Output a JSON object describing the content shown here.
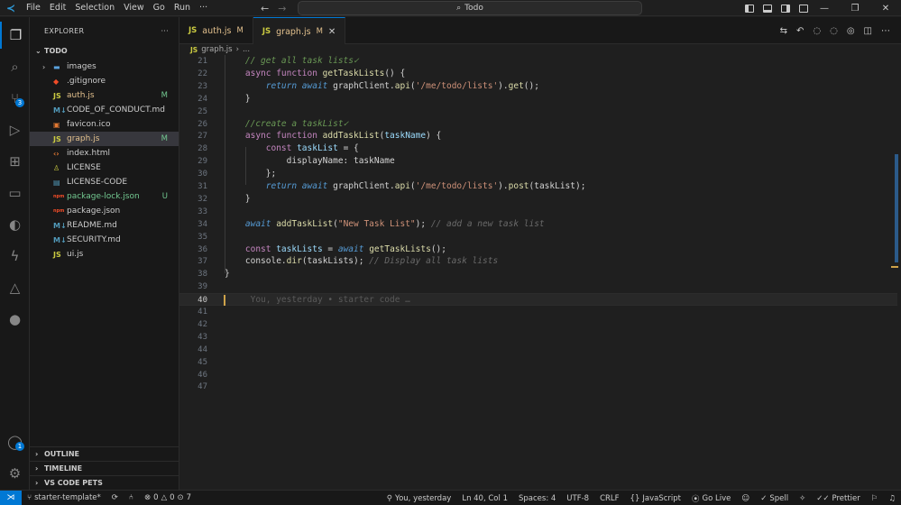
{
  "menu": [
    "File",
    "Edit",
    "Selection",
    "View",
    "Go",
    "Run",
    "···"
  ],
  "command_center": {
    "text": "Todo"
  },
  "explorer": {
    "title": "EXPLORER",
    "more": "···",
    "folder": "TODO",
    "items": [
      {
        "name": "images",
        "type": "folder",
        "status": "",
        "badge": ""
      },
      {
        "name": ".gitignore",
        "type": "git",
        "status": "",
        "badge": ""
      },
      {
        "name": "auth.js",
        "type": "js",
        "status": "modified",
        "badge": "M"
      },
      {
        "name": "CODE_OF_CONDUCT.md",
        "type": "md",
        "status": "",
        "badge": ""
      },
      {
        "name": "favicon.ico",
        "type": "ico",
        "status": "",
        "badge": ""
      },
      {
        "name": "graph.js",
        "type": "js",
        "status": "modified",
        "badge": "M"
      },
      {
        "name": "index.html",
        "type": "html",
        "status": "",
        "badge": ""
      },
      {
        "name": "LICENSE",
        "type": "license",
        "status": "",
        "badge": ""
      },
      {
        "name": "LICENSE-CODE",
        "type": "license-code",
        "status": "",
        "badge": ""
      },
      {
        "name": "package-lock.json",
        "type": "npm",
        "status": "untracked",
        "badge": "U"
      },
      {
        "name": "package.json",
        "type": "npm",
        "status": "",
        "badge": ""
      },
      {
        "name": "README.md",
        "type": "md",
        "status": "",
        "badge": ""
      },
      {
        "name": "SECURITY.md",
        "type": "md",
        "status": "",
        "badge": ""
      },
      {
        "name": "ui.js",
        "type": "js",
        "status": "",
        "badge": ""
      }
    ],
    "sections": [
      "OUTLINE",
      "TIMELINE",
      "VS CODE PETS"
    ]
  },
  "tabs": [
    {
      "lang": "JS",
      "name": "auth.js",
      "badge": "M",
      "active": false
    },
    {
      "lang": "JS",
      "name": "graph.js",
      "badge": "M",
      "active": true
    }
  ],
  "breadcrumb": {
    "lang": "JS",
    "file": "graph.js",
    "sep": "›",
    "more": "..."
  },
  "editor": {
    "lines": [
      {
        "n": "21",
        "tokens": [
          [
            "cm",
            "    // get all task lists✓"
          ]
        ]
      },
      {
        "n": "22",
        "tokens": [
          [
            "kw",
            "    async function "
          ],
          [
            "fn",
            "getTaskLists"
          ],
          [
            "plain",
            "() {"
          ]
        ]
      },
      {
        "n": "23",
        "tokens": [
          [
            "it",
            "        return await "
          ],
          [
            "plain",
            "graphClient."
          ],
          [
            "fn",
            "api"
          ],
          [
            "plain",
            "("
          ],
          [
            "str",
            "'/me/todo/lists'"
          ],
          [
            "plain",
            ")."
          ],
          [
            "fn",
            "get"
          ],
          [
            "plain",
            "();"
          ]
        ]
      },
      {
        "n": "24",
        "tokens": [
          [
            "plain",
            "    }"
          ]
        ]
      },
      {
        "n": "25",
        "tokens": [
          [
            "plain",
            ""
          ]
        ]
      },
      {
        "n": "26",
        "tokens": [
          [
            "cm",
            "    //create a taskList✓"
          ]
        ]
      },
      {
        "n": "27",
        "tokens": [
          [
            "kw",
            "    async function "
          ],
          [
            "fn",
            "addTaskList"
          ],
          [
            "plain",
            "("
          ],
          [
            "var",
            "taskName"
          ],
          [
            "plain",
            ") {"
          ]
        ]
      },
      {
        "n": "28",
        "tokens": [
          [
            "kw",
            "        const "
          ],
          [
            "var",
            "taskList"
          ],
          [
            "plain",
            " = {"
          ]
        ]
      },
      {
        "n": "29",
        "tokens": [
          [
            "plain",
            "            displayName: taskName"
          ]
        ]
      },
      {
        "n": "30",
        "tokens": [
          [
            "plain",
            "        };"
          ]
        ]
      },
      {
        "n": "31",
        "tokens": [
          [
            "it",
            "        return await "
          ],
          [
            "plain",
            "graphClient."
          ],
          [
            "fn",
            "api"
          ],
          [
            "plain",
            "("
          ],
          [
            "str",
            "'/me/todo/lists'"
          ],
          [
            "plain",
            ")."
          ],
          [
            "fn",
            "post"
          ],
          [
            "plain",
            "(taskList);"
          ]
        ]
      },
      {
        "n": "32",
        "tokens": [
          [
            "plain",
            "    }"
          ]
        ]
      },
      {
        "n": "33",
        "tokens": [
          [
            "plain",
            ""
          ]
        ]
      },
      {
        "n": "34",
        "tokens": [
          [
            "it",
            "    await "
          ],
          [
            "fn",
            "addTaskList"
          ],
          [
            "plain",
            "("
          ],
          [
            "str",
            "\"New Task List\""
          ],
          [
            "plain",
            "); "
          ],
          [
            "gray",
            "// add a new task list"
          ]
        ]
      },
      {
        "n": "35",
        "tokens": [
          [
            "plain",
            ""
          ]
        ]
      },
      {
        "n": "36",
        "tokens": [
          [
            "kw",
            "    const "
          ],
          [
            "var",
            "taskLists"
          ],
          [
            "plain",
            " = "
          ],
          [
            "it",
            "await "
          ],
          [
            "fn",
            "getTaskLists"
          ],
          [
            "plain",
            "();"
          ]
        ]
      },
      {
        "n": "37",
        "tokens": [
          [
            "plain",
            "    console."
          ],
          [
            "fn",
            "dir"
          ],
          [
            "plain",
            "(taskLists); "
          ],
          [
            "gray",
            "// Display all task lists"
          ]
        ]
      },
      {
        "n": "38",
        "tokens": [
          [
            "plain",
            "}"
          ]
        ]
      },
      {
        "n": "39",
        "tokens": [
          [
            "plain",
            ""
          ]
        ]
      },
      {
        "n": "40",
        "tokens": [
          [
            "ghost",
            "     You, yesterday • starter code …"
          ]
        ],
        "current": true
      },
      {
        "n": "41",
        "tokens": []
      },
      {
        "n": "42",
        "tokens": []
      },
      {
        "n": "43",
        "tokens": []
      },
      {
        "n": "44",
        "tokens": []
      },
      {
        "n": "45",
        "tokens": []
      },
      {
        "n": "46",
        "tokens": []
      },
      {
        "n": "47",
        "tokens": []
      }
    ]
  },
  "statusbar": {
    "branch": "starter-template*",
    "errors": "0",
    "warnings": "0",
    "ports": "7",
    "blame": "You, yesterday",
    "position": "Ln 40, Col 1",
    "spaces": "Spaces: 4",
    "encoding": "UTF-8",
    "eol": "CRLF",
    "language": "JavaScript",
    "golive": "Go Live",
    "spell": "Spell",
    "prettier": "Prettier"
  },
  "colors": {
    "accent": "#0078d4",
    "modified": "#e2c08d",
    "untracked": "#73c991"
  }
}
